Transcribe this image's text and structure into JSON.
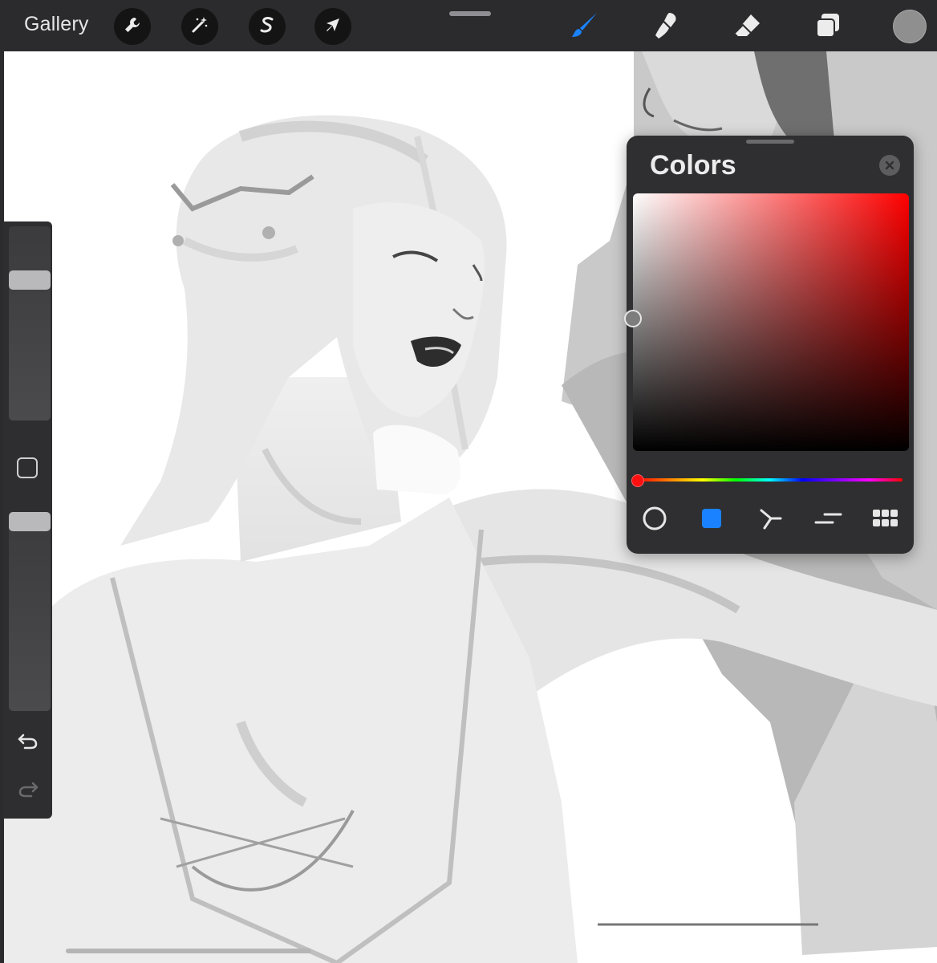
{
  "toolbar": {
    "gallery_label": "Gallery",
    "left_tools": [
      {
        "name": "actions",
        "icon": "wrench-icon"
      },
      {
        "name": "adjustments",
        "icon": "magic-wand-icon"
      },
      {
        "name": "selection",
        "icon": "selection-s-icon"
      },
      {
        "name": "transform",
        "icon": "arrow-cursor-icon"
      }
    ],
    "right_tools": [
      {
        "name": "brush",
        "icon": "brush-icon",
        "active": true
      },
      {
        "name": "smudge",
        "icon": "smudge-finger-icon",
        "active": false
      },
      {
        "name": "eraser",
        "icon": "eraser-icon",
        "active": false
      },
      {
        "name": "layers",
        "icon": "layers-icon",
        "active": false
      }
    ],
    "current_color": "#8f8f8f",
    "accent_color": "#1a82ff"
  },
  "sidebar": {
    "brush_size_level": 0.75,
    "opacity_level": 1.0,
    "modify_icon": "square-modify-icon",
    "undo_icon": "undo-icon",
    "redo_icon": "redo-icon"
  },
  "colors_panel": {
    "title": "Colors",
    "close_icon": "close-icon",
    "hue": "#ff0000",
    "modes": [
      {
        "name": "disc",
        "icon": "circle-icon",
        "active": false
      },
      {
        "name": "classic",
        "icon": "square-icon",
        "active": true
      },
      {
        "name": "harmony",
        "icon": "harmony-icon",
        "active": false
      },
      {
        "name": "value",
        "icon": "sliders-icon",
        "active": false
      },
      {
        "name": "palettes",
        "icon": "grid-icon",
        "active": false
      }
    ]
  }
}
